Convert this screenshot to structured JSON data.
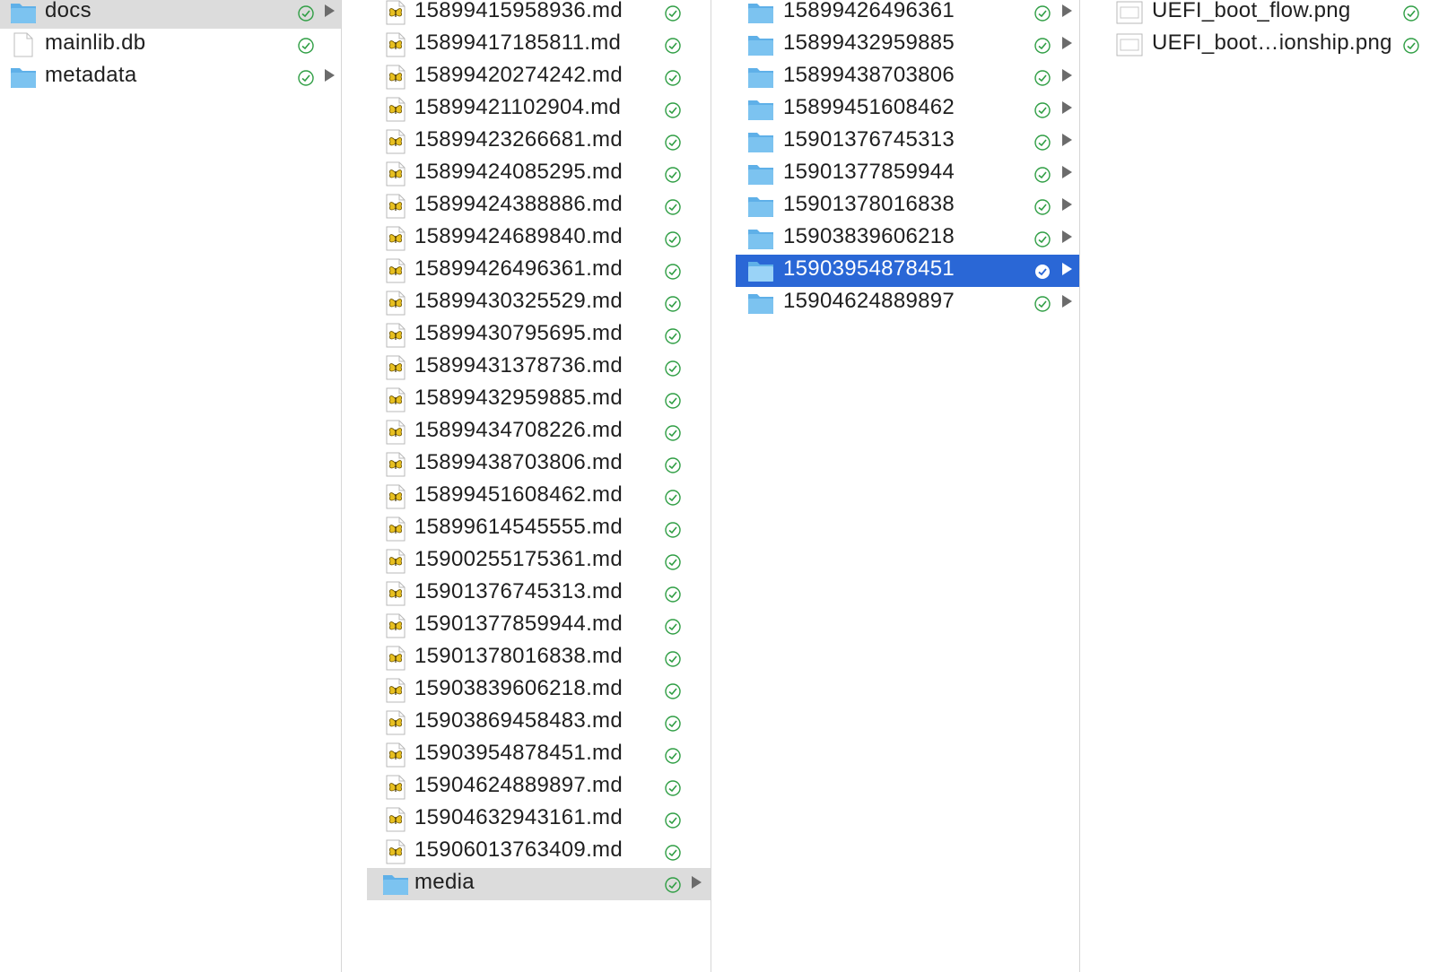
{
  "columns": [
    {
      "items": [
        {
          "name": "docs",
          "type": "folder",
          "status": "synced",
          "has_children": true,
          "state": "ancestor"
        },
        {
          "name": "mainlib.db",
          "type": "file",
          "status": "synced",
          "has_children": false,
          "state": "normal"
        },
        {
          "name": "metadata",
          "type": "folder",
          "status": "synced",
          "has_children": true,
          "state": "normal"
        }
      ]
    },
    {
      "items": [
        {
          "name": "15899415958936.md",
          "type": "markdown",
          "status": "synced",
          "has_children": false,
          "state": "normal"
        },
        {
          "name": "15899417185811.md",
          "type": "markdown",
          "status": "synced",
          "has_children": false,
          "state": "normal"
        },
        {
          "name": "15899420274242.md",
          "type": "markdown",
          "status": "synced",
          "has_children": false,
          "state": "normal"
        },
        {
          "name": "15899421102904.md",
          "type": "markdown",
          "status": "synced",
          "has_children": false,
          "state": "normal"
        },
        {
          "name": "15899423266681.md",
          "type": "markdown",
          "status": "synced",
          "has_children": false,
          "state": "normal"
        },
        {
          "name": "15899424085295.md",
          "type": "markdown",
          "status": "synced",
          "has_children": false,
          "state": "normal"
        },
        {
          "name": "15899424388886.md",
          "type": "markdown",
          "status": "synced",
          "has_children": false,
          "state": "normal"
        },
        {
          "name": "15899424689840.md",
          "type": "markdown",
          "status": "synced",
          "has_children": false,
          "state": "normal"
        },
        {
          "name": "15899426496361.md",
          "type": "markdown",
          "status": "synced",
          "has_children": false,
          "state": "normal"
        },
        {
          "name": "15899430325529.md",
          "type": "markdown",
          "status": "synced",
          "has_children": false,
          "state": "normal"
        },
        {
          "name": "15899430795695.md",
          "type": "markdown",
          "status": "synced",
          "has_children": false,
          "state": "normal"
        },
        {
          "name": "15899431378736.md",
          "type": "markdown",
          "status": "synced",
          "has_children": false,
          "state": "normal"
        },
        {
          "name": "15899432959885.md",
          "type": "markdown",
          "status": "synced",
          "has_children": false,
          "state": "normal"
        },
        {
          "name": "15899434708226.md",
          "type": "markdown",
          "status": "synced",
          "has_children": false,
          "state": "normal"
        },
        {
          "name": "15899438703806.md",
          "type": "markdown",
          "status": "synced",
          "has_children": false,
          "state": "normal"
        },
        {
          "name": "15899451608462.md",
          "type": "markdown",
          "status": "synced",
          "has_children": false,
          "state": "normal"
        },
        {
          "name": "15899614545555.md",
          "type": "markdown",
          "status": "synced",
          "has_children": false,
          "state": "normal"
        },
        {
          "name": "15900255175361.md",
          "type": "markdown",
          "status": "synced",
          "has_children": false,
          "state": "normal"
        },
        {
          "name": "15901376745313.md",
          "type": "markdown",
          "status": "synced",
          "has_children": false,
          "state": "normal"
        },
        {
          "name": "15901377859944.md",
          "type": "markdown",
          "status": "synced",
          "has_children": false,
          "state": "normal"
        },
        {
          "name": "15901378016838.md",
          "type": "markdown",
          "status": "synced",
          "has_children": false,
          "state": "normal"
        },
        {
          "name": "15903839606218.md",
          "type": "markdown",
          "status": "synced",
          "has_children": false,
          "state": "normal"
        },
        {
          "name": "15903869458483.md",
          "type": "markdown",
          "status": "synced",
          "has_children": false,
          "state": "normal"
        },
        {
          "name": "15903954878451.md",
          "type": "markdown",
          "status": "synced",
          "has_children": false,
          "state": "normal"
        },
        {
          "name": "15904624889897.md",
          "type": "markdown",
          "status": "synced",
          "has_children": false,
          "state": "normal"
        },
        {
          "name": "15904632943161.md",
          "type": "markdown",
          "status": "synced",
          "has_children": false,
          "state": "normal"
        },
        {
          "name": "15906013763409.md",
          "type": "markdown",
          "status": "synced",
          "has_children": false,
          "state": "normal"
        },
        {
          "name": "media",
          "type": "folder",
          "status": "synced",
          "has_children": true,
          "state": "ancestor"
        }
      ]
    },
    {
      "items": [
        {
          "name": "15899426496361",
          "type": "folder",
          "status": "synced",
          "has_children": true,
          "state": "normal"
        },
        {
          "name": "15899432959885",
          "type": "folder",
          "status": "synced",
          "has_children": true,
          "state": "normal"
        },
        {
          "name": "15899438703806",
          "type": "folder",
          "status": "synced",
          "has_children": true,
          "state": "normal"
        },
        {
          "name": "15899451608462",
          "type": "folder",
          "status": "synced",
          "has_children": true,
          "state": "normal"
        },
        {
          "name": "15901376745313",
          "type": "folder",
          "status": "synced",
          "has_children": true,
          "state": "normal"
        },
        {
          "name": "15901377859944",
          "type": "folder",
          "status": "synced",
          "has_children": true,
          "state": "normal"
        },
        {
          "name": "15901378016838",
          "type": "folder",
          "status": "synced",
          "has_children": true,
          "state": "normal"
        },
        {
          "name": "15903839606218",
          "type": "folder",
          "status": "synced",
          "has_children": true,
          "state": "normal"
        },
        {
          "name": "15903954878451",
          "type": "folder",
          "status": "synced",
          "has_children": true,
          "state": "selected"
        },
        {
          "name": "15904624889897",
          "type": "folder",
          "status": "synced",
          "has_children": true,
          "state": "normal"
        }
      ]
    },
    {
      "items": [
        {
          "name": "UEFI_boot_flow.png",
          "type": "image",
          "status": "synced",
          "has_children": false,
          "state": "normal"
        },
        {
          "name": "UEFI_boot…ionship.png",
          "type": "image",
          "status": "synced",
          "has_children": false,
          "state": "normal"
        }
      ]
    }
  ],
  "colors": {
    "selection": "#2a67d6",
    "ancestor": "#dcdcdc",
    "folder": "#7cc3f0",
    "sync_check": "#2f9e44",
    "arrow": "#6b6b6b"
  },
  "icons": {
    "folder": "folder-icon",
    "file": "document-icon",
    "markdown": "markdown-file-icon",
    "image": "image-file-icon",
    "status": "sync-check-icon",
    "expand": "disclosure-arrow-icon"
  }
}
